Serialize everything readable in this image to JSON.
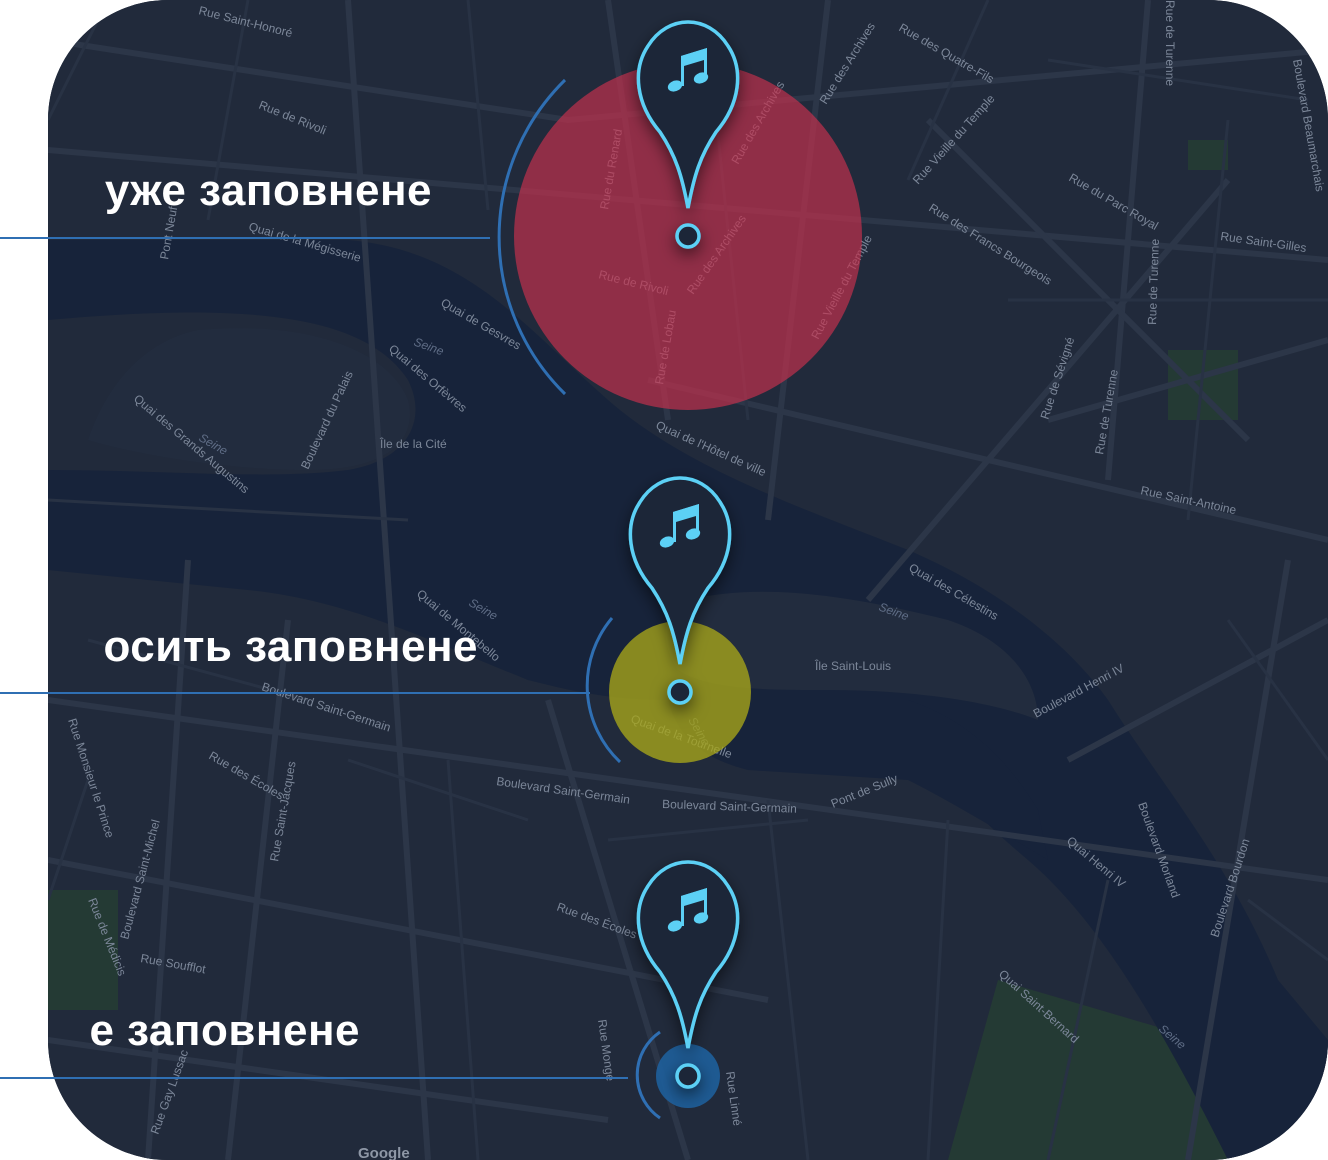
{
  "zones": [
    {
      "id": "full",
      "label": "уже заповнене",
      "level": "full",
      "color": "#c6304d"
    },
    {
      "id": "nearly",
      "label": "осить заповнене",
      "level": "nearly-full",
      "color": "#a8a61a"
    },
    {
      "id": "empty",
      "label": "е заповнене",
      "level": "not-full",
      "color": "#1e5f9c"
    }
  ],
  "pin_icon": "music-note-icon",
  "colors": {
    "pin_fill": "#1b2638",
    "pin_stroke": "#5bd0f5",
    "accent_line": "#2f6fb3",
    "map_bg": "#212a3b",
    "water": "#17233a"
  },
  "map": {
    "streets": [
      "Rue Saint-Honoré",
      "Rue de Rivoli",
      "Quai de la Mégisserie",
      "Pont Neuf",
      "Quai de Gesvres",
      "Rue du Renard",
      "Rue des Archives",
      "Rue de Rivoli",
      "Rue de Lobau",
      "Rue Vieille du Temple",
      "Rue des Archives",
      "Rue des Quatre-Fils",
      "Rue Vieille du Temple",
      "Rue des Francs Bourgeois",
      "Rue du Parc Royal",
      "Rue Saint-Gilles",
      "Rue de Turenne",
      "Rue de Turenne",
      "Rue de Sévigné",
      "Rue de Turenne",
      "Rue Saint-Antoine",
      "Quai de l'Hôtel de ville",
      "Boulevard du Palais",
      "Quai des Grands Augustins",
      "Quai de Montebello",
      "Quai des Célestins",
      "Boulevard Henri IV",
      "Boulevard Saint-Germain",
      "Rue des Écoles",
      "Boulevard Saint-Germain",
      "Boulevard Saint-Germain",
      "Pont de Sully",
      "Quai de la Tournelle",
      "Quai Henri IV",
      "Boulevard Morland",
      "Boulevard Bourdon",
      "Rue des Écoles",
      "Rue Monge",
      "Rue Linné",
      "Quai Saint-Bernard",
      "Rue Soufflot",
      "Rue Saint-Jacques",
      "Boulevard Saint-Michel",
      "Rue Monsieur le Prince",
      "Rue de Médicis",
      "Rue Gay Lussac",
      "Boulevard Beaumarchais",
      "Quai des Orfèvres",
      "Rue des Archives"
    ],
    "water_labels": [
      "Seine",
      "Seine",
      "Seine",
      "Seine",
      "Seine",
      "Seine"
    ],
    "districts": [
      "Île de la Cité",
      "Île Saint-Louis"
    ],
    "attribution": "Google"
  }
}
